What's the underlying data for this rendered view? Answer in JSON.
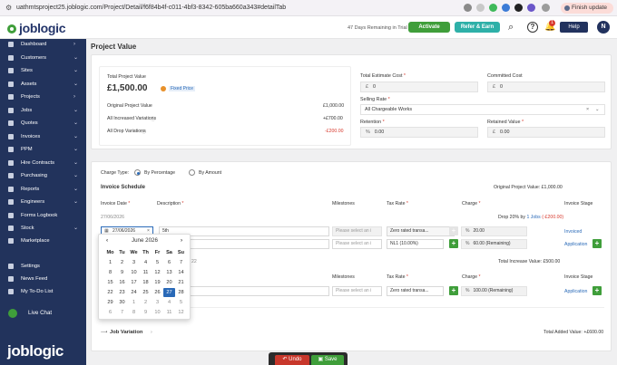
{
  "browser": {
    "url": "uathmtsproject25.joblogic.com/Project/Detail/f6f84b4f-c011-4bf3-8342-605ba660a343#detailTab",
    "finish_update": "Finish update"
  },
  "header": {
    "brand": "joblogic",
    "trial_text": "47 Days Remaining in Trial",
    "activate_label": "Activate",
    "refer_label": "Refer & Earn",
    "notification_count": "1",
    "help_label": "Help",
    "avatar_initial": "N"
  },
  "sidebar": {
    "items": [
      {
        "label": "Dashboard",
        "chevron": "›"
      },
      {
        "label": "Customers",
        "chevron": "⌄"
      },
      {
        "label": "Sites",
        "chevron": "⌄"
      },
      {
        "label": "Assets",
        "chevron": "⌄"
      },
      {
        "label": "Projects",
        "chevron": "›"
      },
      {
        "label": "Jobs",
        "chevron": "⌄"
      },
      {
        "label": "Quotes",
        "chevron": "⌄"
      },
      {
        "label": "Invoices",
        "chevron": "⌄"
      },
      {
        "label": "PPM",
        "chevron": "⌄"
      },
      {
        "label": "Hire Contracts",
        "chevron": "⌄"
      },
      {
        "label": "Purchasing",
        "chevron": "⌄"
      },
      {
        "label": "Reports",
        "chevron": "⌄"
      },
      {
        "label": "Engineers",
        "chevron": "⌄"
      },
      {
        "label": "Forms Logbook",
        "chevron": ""
      },
      {
        "label": "Stock",
        "chevron": "⌄"
      },
      {
        "label": "Marketplace",
        "chevron": ""
      }
    ],
    "bottom_items": [
      {
        "label": "Settings"
      },
      {
        "label": "News Feed"
      },
      {
        "label": "My To-Do List"
      }
    ],
    "live_chat": "Live Chat",
    "footer_brand": "joblogic"
  },
  "page": {
    "title": "Project Value",
    "summary": {
      "total_label": "Total Project Value",
      "total_value": "£1,500.00",
      "fixed_price": "Fixed Price",
      "rows": [
        {
          "label": "Original Project Value",
          "value": "£1,000.00"
        },
        {
          "label": "All Increased Variations",
          "value": "+£700.00"
        },
        {
          "label": "All Drop Variations",
          "value": "-£200.00"
        }
      ]
    },
    "fields": {
      "total_estimate_cost_label": "Total Estimate Cost",
      "total_estimate_cost_currency": "£",
      "total_estimate_cost_value": "0",
      "committed_cost_label": "Committed Cost",
      "committed_cost_currency": "£",
      "committed_cost_value": "0",
      "selling_rate_label": "Selling Rate",
      "selling_rate_value": "All Chargeable Works",
      "retention_label": "Retention",
      "retention_unit": "%",
      "retention_value": "0.00",
      "retained_value_label": "Retained Value",
      "retained_value_currency": "£",
      "retained_value_value": "0.00"
    },
    "charge": {
      "label": "Charge Type:",
      "opt_percentage": "By Percentage",
      "opt_amount": "By Amount"
    },
    "invoice_schedule": {
      "title": "Invoice Schedule",
      "original_value": "Original Project Value: £1,000.00",
      "columns": {
        "invoice_date": "Invoice Date",
        "description": "Description",
        "milestones": "Milestones",
        "tax_rate": "Tax Rate",
        "charge": "Charge",
        "invoice_stage": "Invoice Stage"
      },
      "date_row": "27/06/2026",
      "drop_prefix": "Drop 20% by",
      "drop_link": "1 Jobs",
      "drop_value": "(-£200.00)",
      "row1": {
        "date": "27/06/2026",
        "description": "5th",
        "milestone_ph": "Please select an i",
        "tax": "Zero rated transa...",
        "unit": "%",
        "charge": "20.00",
        "stage": "Invoiced"
      },
      "row2": {
        "milestone_ph": "Please select an i",
        "tax": "NL1 (10.00%)",
        "unit": "%",
        "charge": "60.00 (Remaining)",
        "stage": "Application"
      },
      "total_increase": "Total Increase Value: £500.00",
      "row3": {
        "date_partial": "22",
        "milestone_ph": "Please select an i",
        "tax": "Zero rated transa...",
        "unit": "%",
        "charge": "100.00 (Remaining)",
        "stage": "Application"
      }
    },
    "job_variation": {
      "label": "Job Variation",
      "total_added": "Total Added Value: +£600.00"
    },
    "calendar": {
      "month": "June 2026",
      "weekdays": [
        "Mo",
        "Tu",
        "We",
        "Th",
        "Fr",
        "Sa",
        "Su"
      ],
      "weeks": [
        [
          "1",
          "2",
          "3",
          "4",
          "5",
          "6",
          "7"
        ],
        [
          "8",
          "9",
          "10",
          "11",
          "12",
          "13",
          "14"
        ],
        [
          "15",
          "16",
          "17",
          "18",
          "19",
          "20",
          "21"
        ],
        [
          "22",
          "23",
          "24",
          "25",
          "26",
          "27",
          "28"
        ],
        [
          "29",
          "30",
          "1",
          "2",
          "3",
          "4",
          "5"
        ],
        [
          "6",
          "7",
          "8",
          "9",
          "10",
          "11",
          "12"
        ]
      ],
      "selected": "27"
    },
    "actions": {
      "undo": "Undo",
      "save": "Save"
    }
  },
  "colors": {
    "sidebar": "#22335c",
    "green": "#3f9e3a",
    "teal": "#2eb0a8",
    "red": "#d83a2e",
    "blue": "#2a6ab8"
  }
}
